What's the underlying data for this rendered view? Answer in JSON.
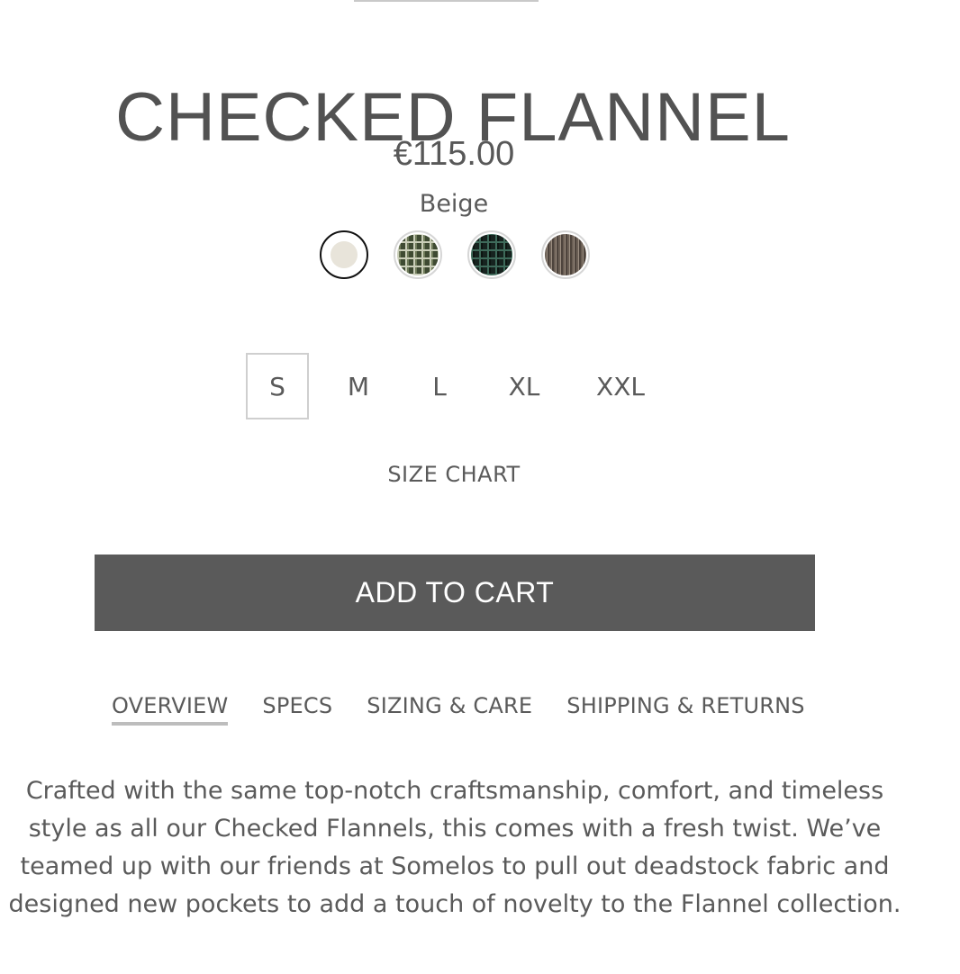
{
  "product": {
    "title": "CHECKED FLANNEL",
    "price": "€115.00",
    "selected_color": "Beige"
  },
  "swatches": [
    {
      "name": "beige-swatch",
      "selected": true,
      "pattern": "solid",
      "colors": [
        "#e8e4da"
      ]
    },
    {
      "name": "green-check-swatch",
      "selected": false,
      "pattern": "check",
      "colors": [
        "#3e4a32",
        "#c9cdb8",
        "#6f7b5a"
      ]
    },
    {
      "name": "dark-green-check-swatch",
      "selected": false,
      "pattern": "check",
      "colors": [
        "#16231f",
        "#3e6a5a",
        "#0d1411"
      ]
    },
    {
      "name": "brown-stripe-swatch",
      "selected": false,
      "pattern": "stripe",
      "colors": [
        "#6b5f55",
        "#9a8d80",
        "#4e443d"
      ]
    }
  ],
  "sizes": [
    {
      "label": "S",
      "selected": true
    },
    {
      "label": "M",
      "selected": false
    },
    {
      "label": "L",
      "selected": false
    },
    {
      "label": "XL",
      "selected": false
    },
    {
      "label": "XXL",
      "selected": false
    }
  ],
  "size_chart_label": "SIZE CHART",
  "add_to_cart_label": "ADD TO CART",
  "tabs": [
    {
      "label": "OVERVIEW",
      "active": true
    },
    {
      "label": "SPECS",
      "active": false
    },
    {
      "label": "SIZING & CARE",
      "active": false
    },
    {
      "label": "SHIPPING & RETURNS",
      "active": false
    }
  ],
  "description_lines": [
    "Crafted with the same top-notch craftsmanship, comfort, and timeless",
    "style as all our Checked Flannels, this comes with a fresh twist. We’ve",
    "teamed up with our friends at Somelos to pull out deadstock fabric and",
    "designed new pockets to add a touch of novelty to the Flannel collection."
  ],
  "colors": {
    "text": "#565656",
    "button_bg": "#5a5a5a",
    "button_text": "#ffffff",
    "tab_underline": "#bdbdbd"
  }
}
